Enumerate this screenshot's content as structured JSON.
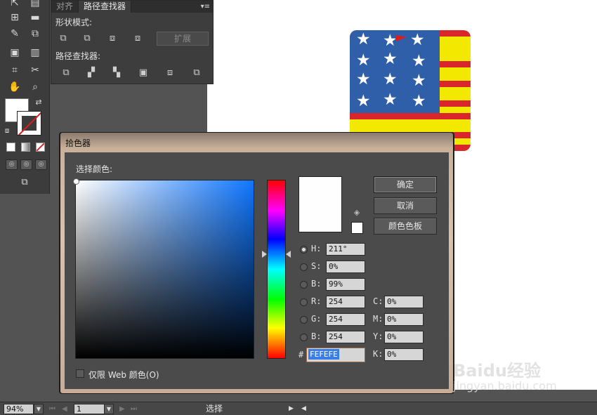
{
  "canvas": {
    "artwork": {
      "stripe_color": "#d9262c",
      "background_color": "#f2e800",
      "canton_color": "#2f5fa8",
      "stars": "★"
    }
  },
  "tools": {
    "icons": [
      "selection-tool-icon",
      "graph-tool-icon",
      "gradient-tool-icon",
      "eyedropper-tool-icon",
      "shape-builder-icon",
      "symbol-sprayer-icon",
      "column-graph-icon",
      "artboard-tool-icon",
      "slice-tool-icon",
      "hand-tool-icon",
      "zoom-tool-icon"
    ]
  },
  "pathfinder": {
    "tabs": [
      "对齐",
      "路径查找器"
    ],
    "menu_icon": "▾≡",
    "shape_modes_label": "形状模式:",
    "expand_label": "扩展",
    "pathfinders_label": "路径查找器:"
  },
  "dialog": {
    "title": "拾色器",
    "select_color_label": "选择颜色:",
    "buttons": {
      "ok": "确定",
      "cancel": "取消",
      "swatches": "颜色色板"
    },
    "hsb": [
      {
        "label": "H:",
        "value": "211°"
      },
      {
        "label": "S:",
        "value": "0%"
      },
      {
        "label": "B:",
        "value": "99%"
      }
    ],
    "rgb": [
      {
        "label": "R:",
        "value": "254"
      },
      {
        "label": "G:",
        "value": "254"
      },
      {
        "label": "B:",
        "value": "254"
      }
    ],
    "cmyk": [
      {
        "label": "C:",
        "value": "0%"
      },
      {
        "label": "M:",
        "value": "0%"
      },
      {
        "label": "Y:",
        "value": "0%"
      },
      {
        "label": "K:",
        "value": "0%"
      }
    ],
    "hex_label": "#",
    "hex_value": "FEFEFE",
    "web_only_label": "仅限 Web 颜色(O)",
    "preview_color": "#fefefe"
  },
  "statusbar": {
    "zoom": "94%",
    "artboard": "1",
    "status_text": "选择"
  },
  "watermark": {
    "logo": "Baidu经验",
    "url": "jingyan.baidu.com"
  }
}
